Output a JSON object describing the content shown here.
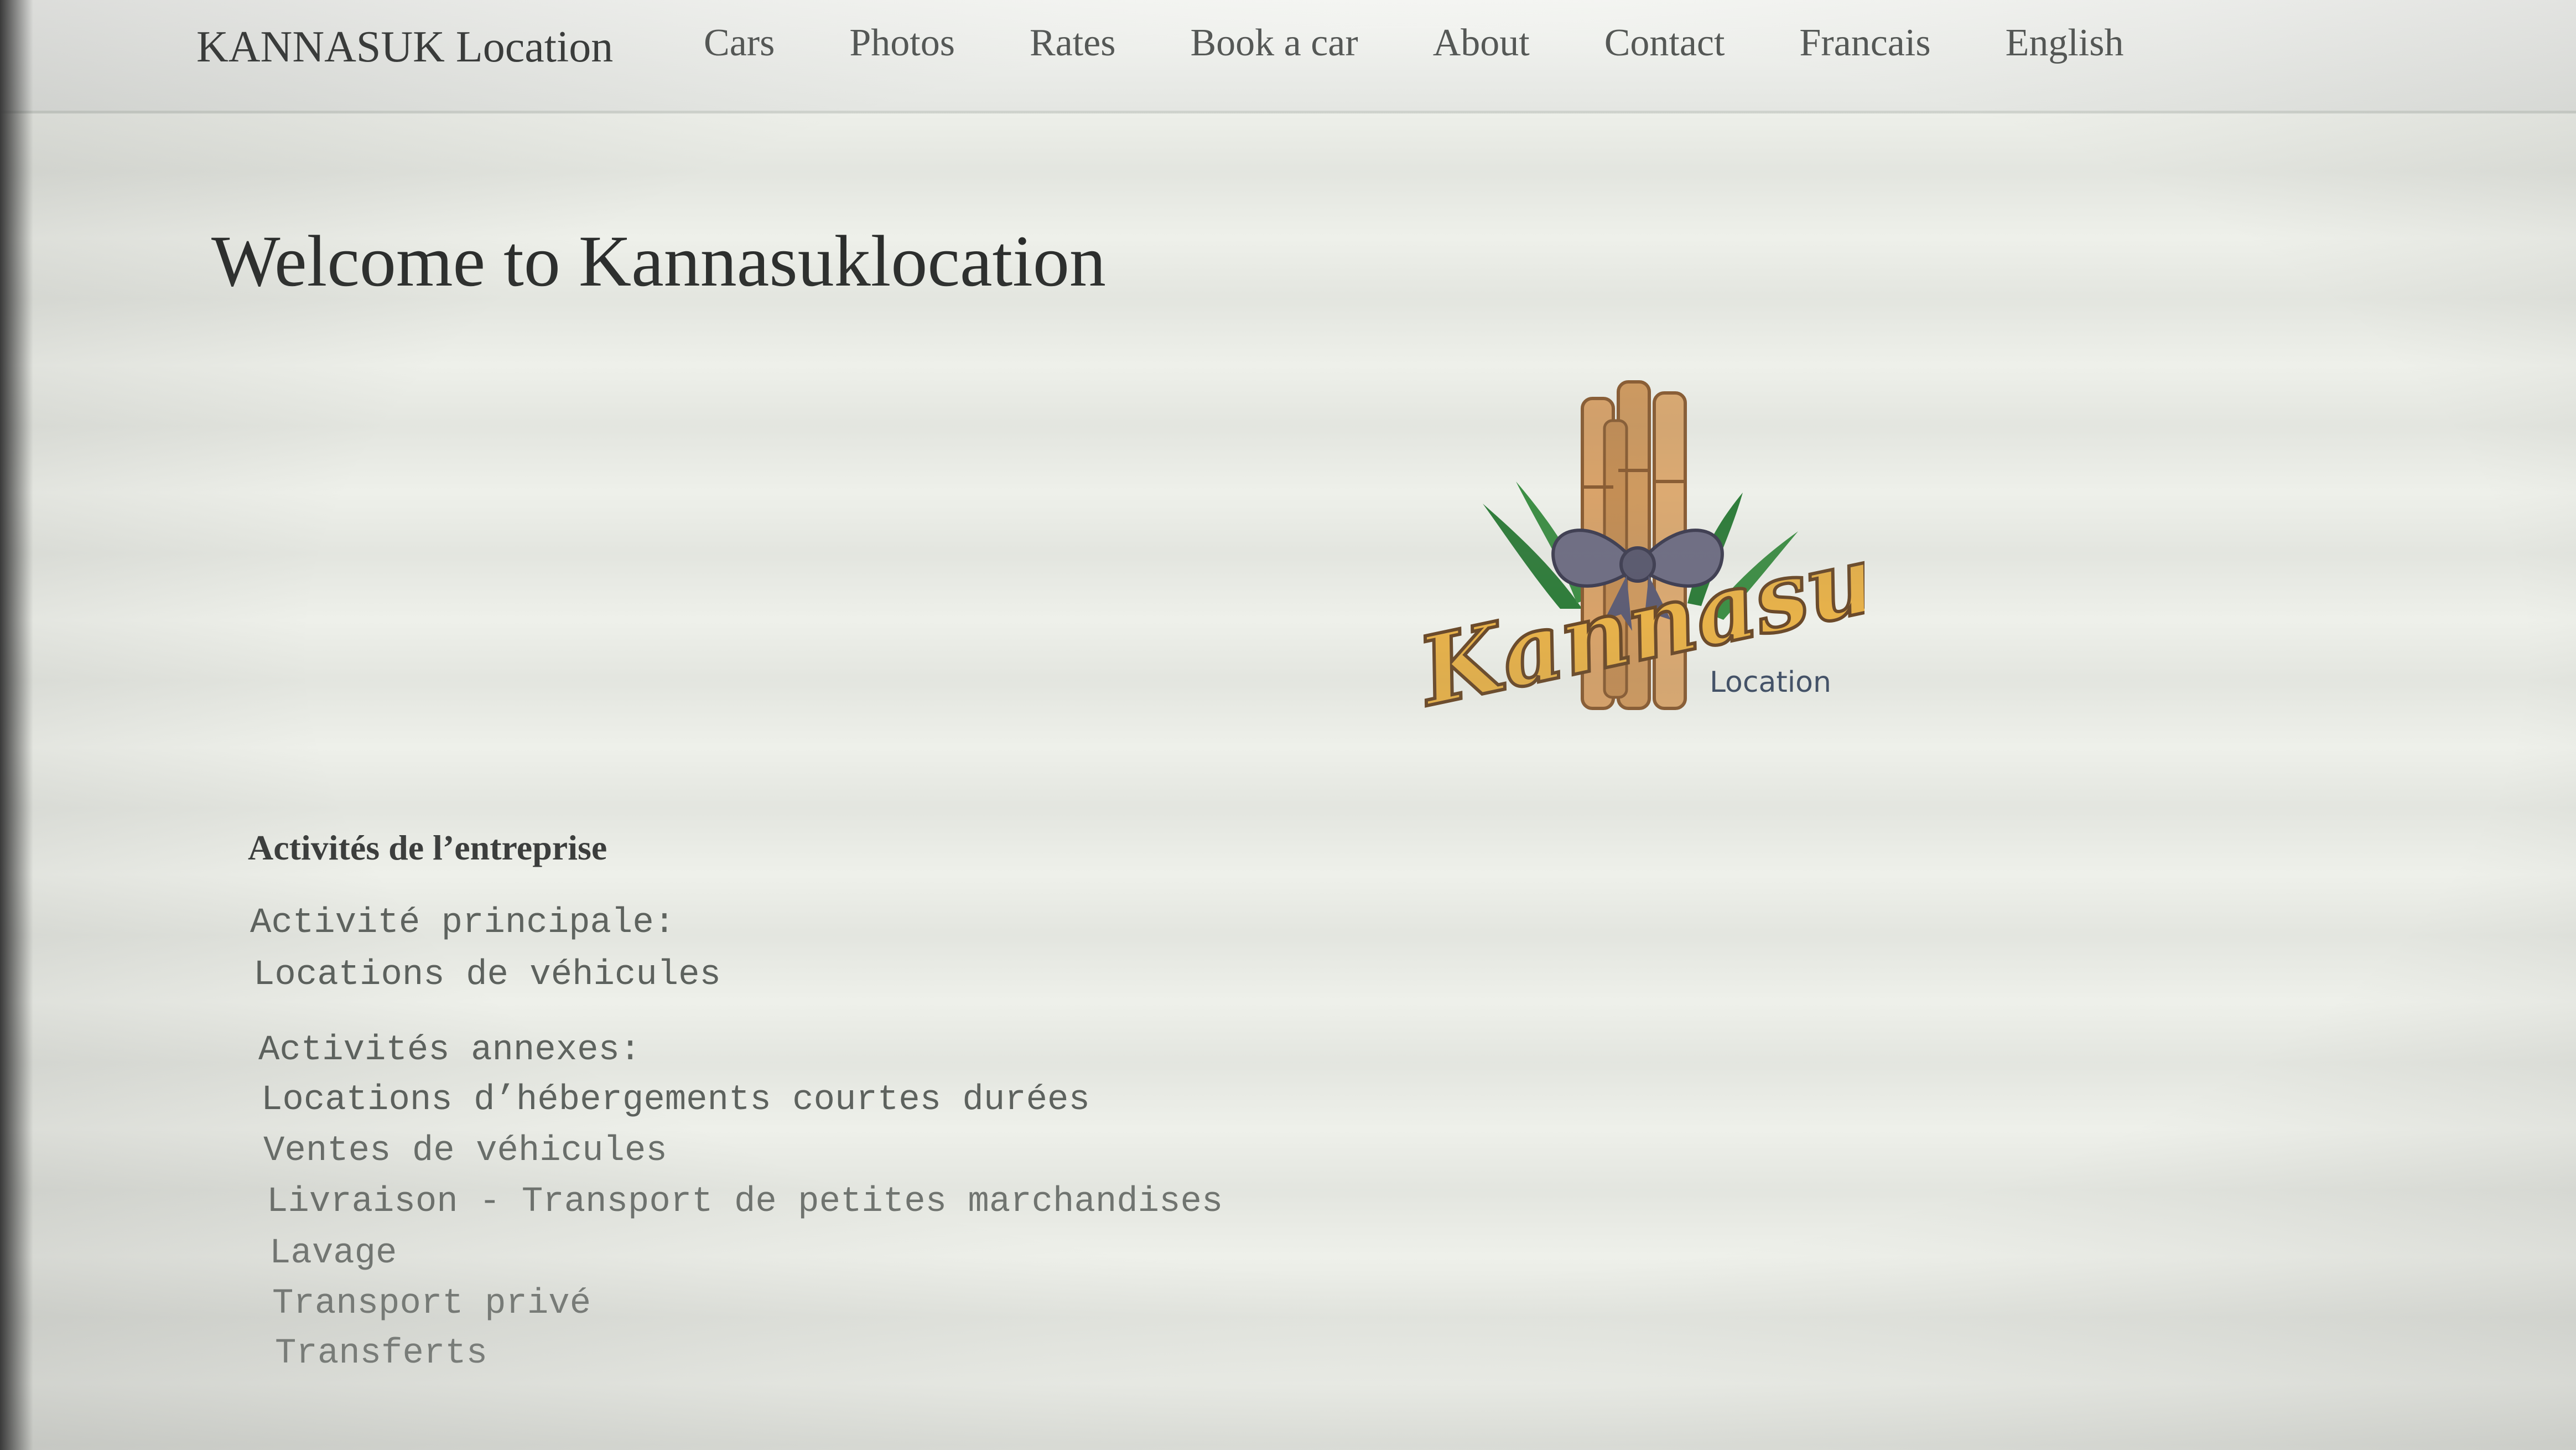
{
  "navbar": {
    "brand": "KANNASUK Location",
    "links": [
      "Cars",
      "Photos",
      "Rates",
      "Book a car",
      "About",
      "Contact",
      "Francais",
      "English"
    ]
  },
  "main": {
    "title": "Welcome to Kannasuklocation",
    "logo": {
      "word": "Kannasuk",
      "sub": "Location",
      "colors": {
        "bamboo": "#d9a36a",
        "leaf": "#2e7d3a",
        "ribbon": "#6f6e85",
        "text_fill": "#e8b24a",
        "text_outline": "#6b4a2a",
        "sub_text": "#3f4e66"
      }
    },
    "activities": {
      "heading": "Activités de l’entreprise",
      "main_label": "Activité principale:",
      "main_item": "Locations de véhicules",
      "annex_label": "Activités annexes:",
      "annex_items": [
        "Locations d’hébergements courtes durées",
        "Ventes de véhicules",
        "Livraison - Transport de petites marchandises",
        "Lavage",
        "Transport privé",
        "Transferts"
      ]
    }
  }
}
